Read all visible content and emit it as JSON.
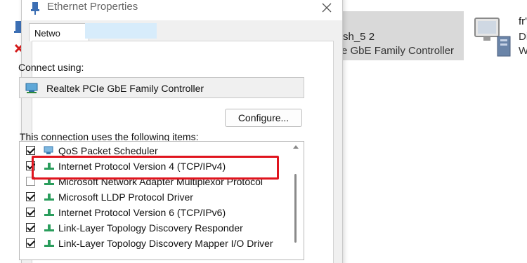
{
  "background": {
    "adapter_line_1": "sh_5 2",
    "adapter_line_2": "e GbE Family Controller",
    "right_line_1": "fr'",
    "right_line_2": "Di",
    "right_line_3": "W"
  },
  "dialog": {
    "title": "Ethernet Properties",
    "close_icon": "close-icon",
    "tab_label": "Netwo",
    "connect_using_label": "Connect using:",
    "adapter_name": "Realtek PCIe GbE Family Controller",
    "configure_label": "Configure...",
    "items_label": "This connection uses the following items:",
    "items": [
      {
        "label": "QoS Packet Scheduler",
        "checked": true,
        "icon": "qos-icon"
      },
      {
        "label": "Internet Protocol Version 4 (TCP/IPv4)",
        "checked": true,
        "icon": "protocol-icon"
      },
      {
        "label": "Microsoft Network Adapter Multiplexor Protocol",
        "checked": false,
        "icon": "protocol-icon"
      },
      {
        "label": "Microsoft LLDP Protocol Driver",
        "checked": true,
        "icon": "protocol-icon"
      },
      {
        "label": "Internet Protocol Version 6 (TCP/IPv6)",
        "checked": true,
        "icon": "protocol-icon"
      },
      {
        "label": "Link-Layer Topology Discovery Responder",
        "checked": true,
        "icon": "protocol-icon"
      },
      {
        "label": "Link-Layer Topology Discovery Mapper I/O Driver",
        "checked": true,
        "icon": "protocol-icon"
      }
    ],
    "highlight_color": "#e0141e"
  }
}
